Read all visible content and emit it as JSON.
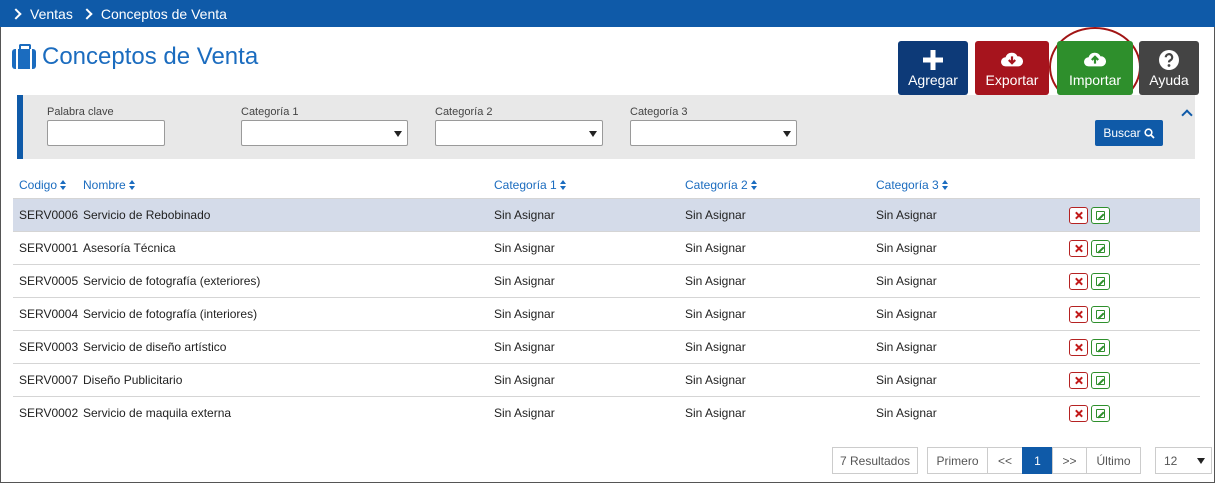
{
  "breadcrumb": {
    "items": [
      "Ventas",
      "Conceptos de Venta"
    ]
  },
  "page": {
    "title": "Conceptos de Venta"
  },
  "actions": {
    "add_label": "Agregar",
    "export_label": "Exportar",
    "import_label": "Importar",
    "help_label": "Ayuda"
  },
  "filters": {
    "keyword_label": "Palabra clave",
    "keyword_value": "",
    "cat1_label": "Categoría 1",
    "cat2_label": "Categoría 2",
    "cat3_label": "Categoría 3",
    "cat1_value": "",
    "cat2_value": "",
    "cat3_value": "",
    "search_label": "Buscar"
  },
  "table": {
    "columns": [
      "Codigo",
      "Nombre",
      "Categoría 1",
      "Categoría 2",
      "Categoría 3"
    ],
    "rows": [
      [
        "SERV0006",
        "Servicio de Rebobinado",
        "Sin Asignar",
        "Sin Asignar",
        "Sin Asignar"
      ],
      [
        "SERV0001",
        "Asesoría Técnica",
        "Sin Asignar",
        "Sin Asignar",
        "Sin Asignar"
      ],
      [
        "SERV0005",
        "Servicio de fotografía (exteriores)",
        "Sin Asignar",
        "Sin Asignar",
        "Sin Asignar"
      ],
      [
        "SERV0004",
        "Servicio de fotografía (interiores)",
        "Sin Asignar",
        "Sin Asignar",
        "Sin Asignar"
      ],
      [
        "SERV0003",
        "Servicio de diseño artístico",
        "Sin Asignar",
        "Sin Asignar",
        "Sin Asignar"
      ],
      [
        "SERV0007",
        "Diseño Publicitario",
        "Sin Asignar",
        "Sin Asignar",
        "Sin Asignar"
      ],
      [
        "SERV0002",
        "Servicio de maquila externa",
        "Sin Asignar",
        "Sin Asignar",
        "Sin Asignar"
      ]
    ],
    "selected_row": 0
  },
  "pagination": {
    "results": "7 Resultados",
    "first": "Primero",
    "prev": "<<",
    "current": "1",
    "next": ">>",
    "last": "Último",
    "page_size": "12"
  },
  "colors": {
    "primary": "#0f5aa8",
    "add": "#0d3a78",
    "export": "#a6141d",
    "import": "#2e8f2c",
    "help": "#444444",
    "highlight_ring": "#a11414"
  },
  "icons": {
    "breadcrumb_separator": "chevron-right-icon",
    "title": "briefcase-icon",
    "add": "plus-icon",
    "export": "cloud-download-icon",
    "import": "cloud-upload-icon",
    "help": "question-circle-icon",
    "search": "search-icon",
    "collapse": "chevron-up-icon",
    "sort": "sort-icon",
    "delete": "delete-icon",
    "edit": "edit-icon"
  }
}
